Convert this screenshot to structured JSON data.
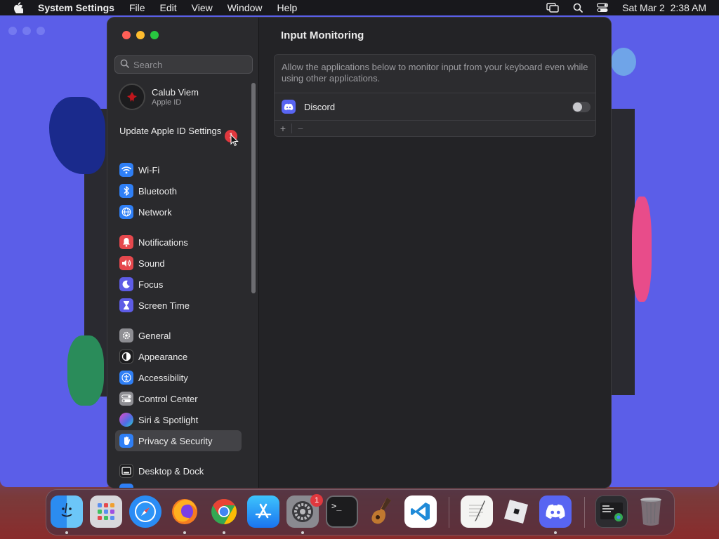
{
  "menubar": {
    "app_name": "System Settings",
    "menus": [
      "File",
      "Edit",
      "View",
      "Window",
      "Help"
    ],
    "datetime": "Sat Mar 2  2:38 AM"
  },
  "sidebar": {
    "search_placeholder": "Search",
    "profile": {
      "name": "Calub Viem",
      "subtitle": "Apple ID"
    },
    "update": {
      "label": "Update Apple ID Settings",
      "badge": "1"
    },
    "items": [
      {
        "label": "Wi-Fi",
        "icon": "wifi-icon",
        "color": "#2f7ff5"
      },
      {
        "label": "Bluetooth",
        "icon": "bluetooth-icon",
        "color": "#2f7ff5"
      },
      {
        "label": "Network",
        "icon": "globe-icon",
        "color": "#2f7ff5"
      },
      {
        "label": "Notifications",
        "icon": "bell-icon",
        "color": "#e5484d"
      },
      {
        "label": "Sound",
        "icon": "speaker-icon",
        "color": "#e5484d"
      },
      {
        "label": "Focus",
        "icon": "moon-icon",
        "color": "#5e5ce6"
      },
      {
        "label": "Screen Time",
        "icon": "hourglass-icon",
        "color": "#5e5ce6"
      },
      {
        "label": "General",
        "icon": "gear-icon",
        "color": "#8e8e93"
      },
      {
        "label": "Appearance",
        "icon": "appearance-icon",
        "color": "#1c1c1e"
      },
      {
        "label": "Accessibility",
        "icon": "accessibility-icon",
        "color": "#2f7ff5"
      },
      {
        "label": "Control Center",
        "icon": "control-center-icon",
        "color": "#8e8e93"
      },
      {
        "label": "Siri & Spotlight",
        "icon": "siri-icon",
        "color": "#a04bd8"
      },
      {
        "label": "Privacy & Security",
        "icon": "hand-icon",
        "color": "#2f7ff5"
      },
      {
        "label": "Desktop & Dock",
        "icon": "dock-icon",
        "color": "#1c1c1e"
      }
    ]
  },
  "content": {
    "title": "Input Monitoring",
    "description": "Allow the applications below to monitor input from your keyboard even while using other applications.",
    "apps": [
      {
        "name": "Discord",
        "icon": "discord-icon",
        "enabled": false
      }
    ],
    "add_label": "+",
    "remove_label": "−"
  },
  "dock": {
    "apps": [
      {
        "name": "Finder",
        "icon": "finder-icon",
        "running": true
      },
      {
        "name": "Launchpad",
        "icon": "launchpad-icon",
        "running": false
      },
      {
        "name": "Safari",
        "icon": "safari-icon",
        "running": false
      },
      {
        "name": "Firefox",
        "icon": "firefox-icon",
        "running": true
      },
      {
        "name": "Chrome",
        "icon": "chrome-icon",
        "running": true
      },
      {
        "name": "App Store",
        "icon": "app-store-icon",
        "running": false
      },
      {
        "name": "System Settings",
        "icon": "system-settings-icon",
        "running": true,
        "badge": "1"
      },
      {
        "name": "Terminal",
        "icon": "terminal-icon",
        "running": false
      },
      {
        "name": "GarageBand",
        "icon": "garageband-icon",
        "running": false
      },
      {
        "name": "VS Code",
        "icon": "vscode-icon",
        "running": false
      },
      {
        "name": "TextEdit",
        "icon": "textedit-icon",
        "running": false
      },
      {
        "name": "Roblox",
        "icon": "roblox-icon",
        "running": false
      },
      {
        "name": "Discord",
        "icon": "discord-icon",
        "running": true
      },
      {
        "name": "Chrome Window",
        "icon": "chrome-window-icon",
        "running": false
      },
      {
        "name": "Trash",
        "icon": "trash-icon",
        "running": false
      }
    ]
  }
}
